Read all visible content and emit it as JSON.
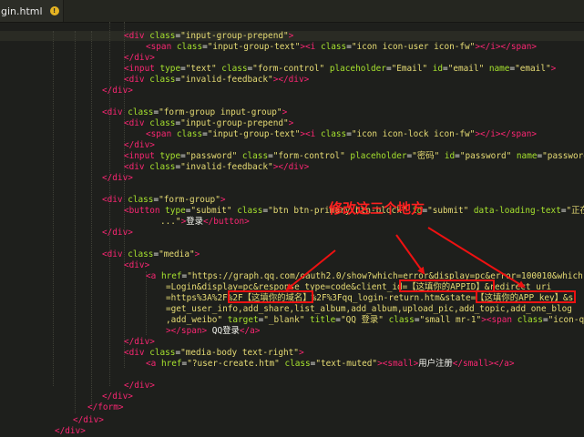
{
  "tab": {
    "filename": "gin.html",
    "dirty_marker": "!"
  },
  "annotation": {
    "label": "修改这三个地方",
    "color": "#ff2020"
  },
  "theme": {
    "tag": "#f92672",
    "attr": "#a6e22e",
    "string": "#e6db74",
    "text": "#f8f8f2",
    "background": "#1e1f1c"
  },
  "code_lines": [
    [
      {
        "t": "tag",
        "v": "<div"
      },
      {
        "t": "attr",
        "v": " class"
      },
      {
        "t": "txt",
        "v": "="
      },
      {
        "t": "str",
        "v": "\"input-group-prepend\""
      },
      {
        "t": "tag",
        "v": ">"
      }
    ],
    [
      {
        "t": "tag",
        "v": "<span"
      },
      {
        "t": "attr",
        "v": " class"
      },
      {
        "t": "txt",
        "v": "="
      },
      {
        "t": "str",
        "v": "\"input-group-text\""
      },
      {
        "t": "tag",
        "v": "><i"
      },
      {
        "t": "attr",
        "v": " class"
      },
      {
        "t": "txt",
        "v": "="
      },
      {
        "t": "str",
        "v": "\"icon icon-user icon-fw\""
      },
      {
        "t": "tag",
        "v": "></i></span>"
      }
    ],
    [
      {
        "t": "tag",
        "v": "</div>"
      }
    ],
    [
      {
        "t": "tag",
        "v": "<input"
      },
      {
        "t": "attr",
        "v": " type"
      },
      {
        "t": "txt",
        "v": "="
      },
      {
        "t": "str",
        "v": "\"text\""
      },
      {
        "t": "attr",
        "v": " class"
      },
      {
        "t": "txt",
        "v": "="
      },
      {
        "t": "str",
        "v": "\"form-control\""
      },
      {
        "t": "attr",
        "v": " placeholder"
      },
      {
        "t": "txt",
        "v": "="
      },
      {
        "t": "str",
        "v": "\"Email\""
      },
      {
        "t": "attr",
        "v": " id"
      },
      {
        "t": "txt",
        "v": "="
      },
      {
        "t": "str",
        "v": "\"email\""
      },
      {
        "t": "attr",
        "v": " name"
      },
      {
        "t": "txt",
        "v": "="
      },
      {
        "t": "str",
        "v": "\"email\""
      },
      {
        "t": "tag",
        "v": ">"
      }
    ],
    [
      {
        "t": "tag",
        "v": "<div"
      },
      {
        "t": "attr",
        "v": " class"
      },
      {
        "t": "txt",
        "v": "="
      },
      {
        "t": "str",
        "v": "\"invalid-feedback\""
      },
      {
        "t": "tag",
        "v": "></div>"
      }
    ],
    [
      {
        "t": "tag",
        "v": "</div>"
      }
    ],
    [],
    [
      {
        "t": "tag",
        "v": "<div"
      },
      {
        "t": "attr",
        "v": " class"
      },
      {
        "t": "txt",
        "v": "="
      },
      {
        "t": "str",
        "v": "\"form-group input-group\""
      },
      {
        "t": "tag",
        "v": ">"
      }
    ],
    [
      {
        "t": "tag",
        "v": "<div"
      },
      {
        "t": "attr",
        "v": " class"
      },
      {
        "t": "txt",
        "v": "="
      },
      {
        "t": "str",
        "v": "\"input-group-prepend\""
      },
      {
        "t": "tag",
        "v": ">"
      }
    ],
    [
      {
        "t": "tag",
        "v": "<span"
      },
      {
        "t": "attr",
        "v": " class"
      },
      {
        "t": "txt",
        "v": "="
      },
      {
        "t": "str",
        "v": "\"input-group-text\""
      },
      {
        "t": "tag",
        "v": "><i"
      },
      {
        "t": "attr",
        "v": " class"
      },
      {
        "t": "txt",
        "v": "="
      },
      {
        "t": "str",
        "v": "\"icon icon-lock icon-fw\""
      },
      {
        "t": "tag",
        "v": "></i></span>"
      }
    ],
    [
      {
        "t": "tag",
        "v": "</div>"
      }
    ],
    [
      {
        "t": "tag",
        "v": "<input"
      },
      {
        "t": "attr",
        "v": " type"
      },
      {
        "t": "txt",
        "v": "="
      },
      {
        "t": "str",
        "v": "\"password\""
      },
      {
        "t": "attr",
        "v": " class"
      },
      {
        "t": "txt",
        "v": "="
      },
      {
        "t": "str",
        "v": "\"form-control\""
      },
      {
        "t": "attr",
        "v": " placeholder"
      },
      {
        "t": "txt",
        "v": "="
      },
      {
        "t": "str",
        "v": "\"密码\""
      },
      {
        "t": "attr",
        "v": " id"
      },
      {
        "t": "txt",
        "v": "="
      },
      {
        "t": "str",
        "v": "\"password\""
      },
      {
        "t": "attr",
        "v": " name"
      },
      {
        "t": "txt",
        "v": "="
      },
      {
        "t": "str",
        "v": "\"password\""
      }
    ],
    [
      {
        "t": "tag",
        "v": "<div"
      },
      {
        "t": "attr",
        "v": " class"
      },
      {
        "t": "txt",
        "v": "="
      },
      {
        "t": "str",
        "v": "\"invalid-feedback\""
      },
      {
        "t": "tag",
        "v": "></div>"
      }
    ],
    [
      {
        "t": "tag",
        "v": "</div>"
      }
    ],
    [],
    [
      {
        "t": "tag",
        "v": "<div"
      },
      {
        "t": "attr",
        "v": " class"
      },
      {
        "t": "txt",
        "v": "="
      },
      {
        "t": "str",
        "v": "\"form-group\""
      },
      {
        "t": "tag",
        "v": ">"
      }
    ],
    [
      {
        "t": "tag",
        "v": "<button"
      },
      {
        "t": "attr",
        "v": " type"
      },
      {
        "t": "txt",
        "v": "="
      },
      {
        "t": "str",
        "v": "\"submit\""
      },
      {
        "t": "attr",
        "v": " class"
      },
      {
        "t": "txt",
        "v": "="
      },
      {
        "t": "str",
        "v": "\"btn btn-primary btn-block\""
      },
      {
        "t": "attr",
        "v": " id"
      },
      {
        "t": "txt",
        "v": "="
      },
      {
        "t": "str",
        "v": "\"submit\""
      },
      {
        "t": "attr",
        "v": " data-loading-text"
      },
      {
        "t": "txt",
        "v": "="
      },
      {
        "t": "str",
        "v": "\"正在提"
      }
    ],
    [
      {
        "t": "str",
        "v": "...\""
      },
      {
        "t": "tag",
        "v": ">"
      },
      {
        "t": "txt",
        "v": "登录"
      },
      {
        "t": "tag",
        "v": "</button>"
      }
    ],
    [
      {
        "t": "tag",
        "v": "</div>"
      }
    ],
    [],
    [
      {
        "t": "tag",
        "v": "<div"
      },
      {
        "t": "attr",
        "v": " class"
      },
      {
        "t": "txt",
        "v": "="
      },
      {
        "t": "str",
        "v": "\"media\""
      },
      {
        "t": "tag",
        "v": ">"
      }
    ],
    [
      {
        "t": "tag",
        "v": "<div>"
      }
    ],
    [
      {
        "t": "tag",
        "v": "<a"
      },
      {
        "t": "attr",
        "v": " href"
      },
      {
        "t": "txt",
        "v": "="
      },
      {
        "t": "str",
        "v": "\"https://graph.qq.com/oauth2.0/show?which=error&display=pc&error=100010&which"
      }
    ],
    [
      {
        "t": "str",
        "v": "=Login&display=pc&response_type=code&client_id=【这填你的APPID】&redirect_uri"
      }
    ],
    [
      {
        "t": "str",
        "v": "=https%3A%2F%2F【这填你的域名】%2F%3Fqq_login-return.htm&state=【这填你的APP key】&s"
      }
    ],
    [
      {
        "t": "str",
        "v": "=get_user_info,add_share,list_album,add_album,upload_pic,add_topic,add_one_blog"
      }
    ],
    [
      {
        "t": "str",
        "v": ",add_weibo\""
      },
      {
        "t": "attr",
        "v": " target"
      },
      {
        "t": "txt",
        "v": "="
      },
      {
        "t": "str",
        "v": "\"_blank\""
      },
      {
        "t": "attr",
        "v": " title"
      },
      {
        "t": "txt",
        "v": "="
      },
      {
        "t": "str",
        "v": "\"QQ 登录\""
      },
      {
        "t": "attr",
        "v": " class"
      },
      {
        "t": "txt",
        "v": "="
      },
      {
        "t": "str",
        "v": "\"small mr-1\""
      },
      {
        "t": "tag",
        "v": "><span"
      },
      {
        "t": "attr",
        "v": " class"
      },
      {
        "t": "txt",
        "v": "="
      },
      {
        "t": "str",
        "v": "\"icon-qq\""
      }
    ],
    [
      {
        "t": "tag",
        "v": "></span>"
      },
      {
        "t": "txt",
        "v": " QQ登录"
      },
      {
        "t": "tag",
        "v": "</a>"
      }
    ],
    [
      {
        "t": "tag",
        "v": "</div>"
      }
    ],
    [
      {
        "t": "tag",
        "v": "<div"
      },
      {
        "t": "attr",
        "v": " class"
      },
      {
        "t": "txt",
        "v": "="
      },
      {
        "t": "str",
        "v": "\"media-body text-right\""
      },
      {
        "t": "tag",
        "v": ">"
      }
    ],
    [
      {
        "t": "tag",
        "v": "<a"
      },
      {
        "t": "attr",
        "v": " href"
      },
      {
        "t": "txt",
        "v": "="
      },
      {
        "t": "str",
        "v": "\"?user-create.htm\""
      },
      {
        "t": "attr",
        "v": " class"
      },
      {
        "t": "txt",
        "v": "="
      },
      {
        "t": "str",
        "v": "\"text-muted\""
      },
      {
        "t": "tag",
        "v": "><small>"
      },
      {
        "t": "txt",
        "v": "用户注册"
      },
      {
        "t": "tag",
        "v": "</small></a>"
      }
    ],
    [],
    [
      {
        "t": "tag",
        "v": "</div>"
      }
    ],
    [
      {
        "t": "tag",
        "v": "</div>"
      }
    ],
    [
      {
        "t": "tag",
        "v": "</form>"
      }
    ],
    [
      {
        "t": "tag",
        "v": "</div>"
      }
    ],
    [
      {
        "t": "tag",
        "v": "</div>"
      }
    ]
  ]
}
